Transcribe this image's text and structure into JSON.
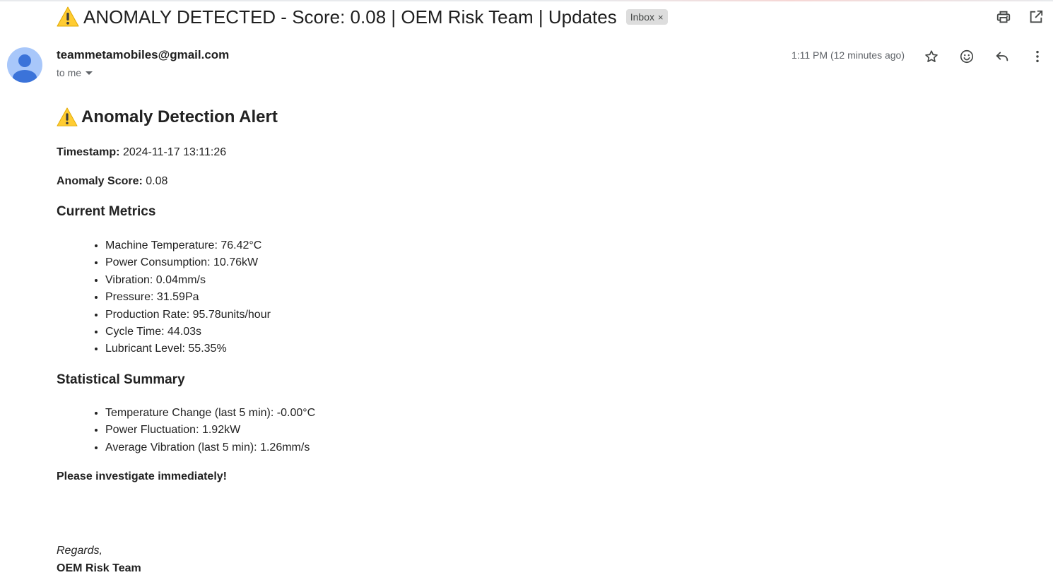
{
  "subject": {
    "text": "ANOMALY DETECTED - Score: 0.08 | OEM Risk Team | Updates",
    "label": "Inbox",
    "label_remove": "×",
    "icon": "warning-icon"
  },
  "toolbar": {
    "print_icon": "print-icon",
    "open_new_window_icon": "open-in-new-icon"
  },
  "message": {
    "sender": "teammetamobiles@gmail.com",
    "recipient": "to me",
    "time": "1:11 PM (12 minutes ago)",
    "actions": [
      "star-icon",
      "emoji-icon",
      "reply-icon",
      "more-vert-icon"
    ]
  },
  "body": {
    "title": "Anomaly Detection Alert",
    "timestamp_label": "Timestamp:",
    "timestamp_value": " 2024-11-17 13:11:26",
    "score_label": "Anomaly Score:",
    "score_value": " 0.08",
    "metrics_heading": "Current Metrics",
    "metrics": [
      "Machine Temperature: 76.42°C",
      "Power Consumption: 10.76kW",
      "Vibration: 0.04mm/s",
      "Pressure: 31.59Pa",
      "Production Rate: 95.78units/hour",
      "Cycle Time: 44.03s",
      "Lubricant Level: 55.35%"
    ],
    "stats_heading": "Statistical Summary",
    "stats": [
      "Temperature Change (last 5 min): -0.00°C",
      "Power Fluctuation: 1.92kW",
      "Average Vibration (last 5 min): 1.26mm/s"
    ],
    "call_to_action": "Please investigate immediately!",
    "closing": "Regards,",
    "signature": "OEM Risk Team"
  },
  "colors": {
    "avatar_bg": "#a8c7fa",
    "avatar_fg": "#3b73d9",
    "warning_yellow": "#ffcc32",
    "label_chip_bg": "#dddddd"
  }
}
